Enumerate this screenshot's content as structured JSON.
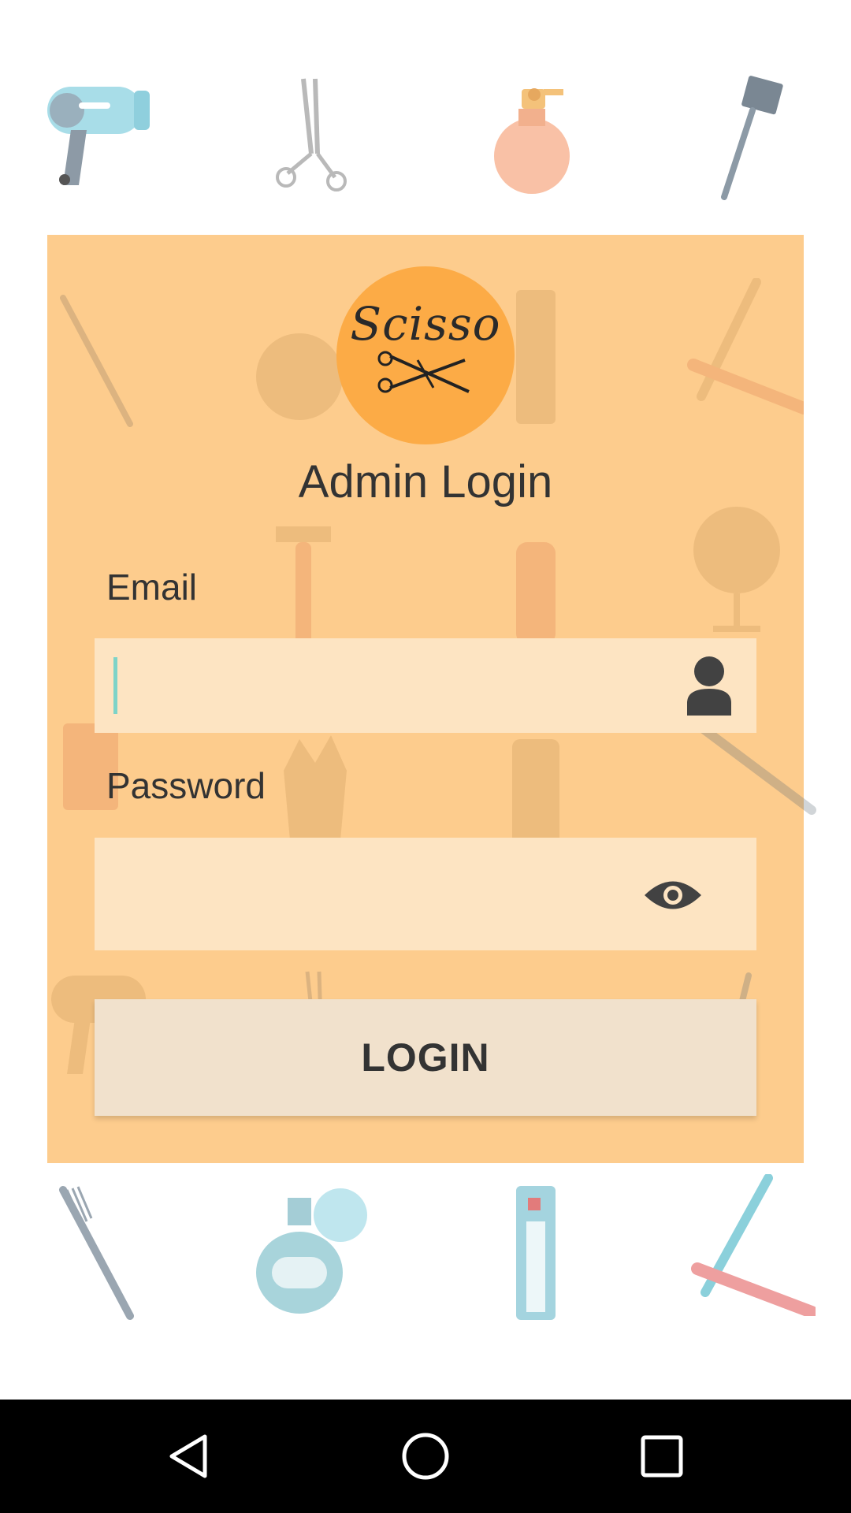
{
  "logo": {
    "text": "Scisso"
  },
  "title": "Admin Login",
  "email": {
    "label": "Email",
    "value": "",
    "placeholder": "",
    "icon": "person-icon"
  },
  "password": {
    "label": "Password",
    "value": "",
    "placeholder": "",
    "icon": "eye-icon"
  },
  "login_button": {
    "label": "LOGIN"
  },
  "nav": {
    "back": "back-icon",
    "home": "home-icon",
    "recents": "recents-icon"
  },
  "colors": {
    "card": "#fdbf70",
    "logo": "#fcab46",
    "field": "#fde4c2",
    "button": "#f1e1cc",
    "text": "#333333",
    "cursor": "#7dd3c8"
  }
}
